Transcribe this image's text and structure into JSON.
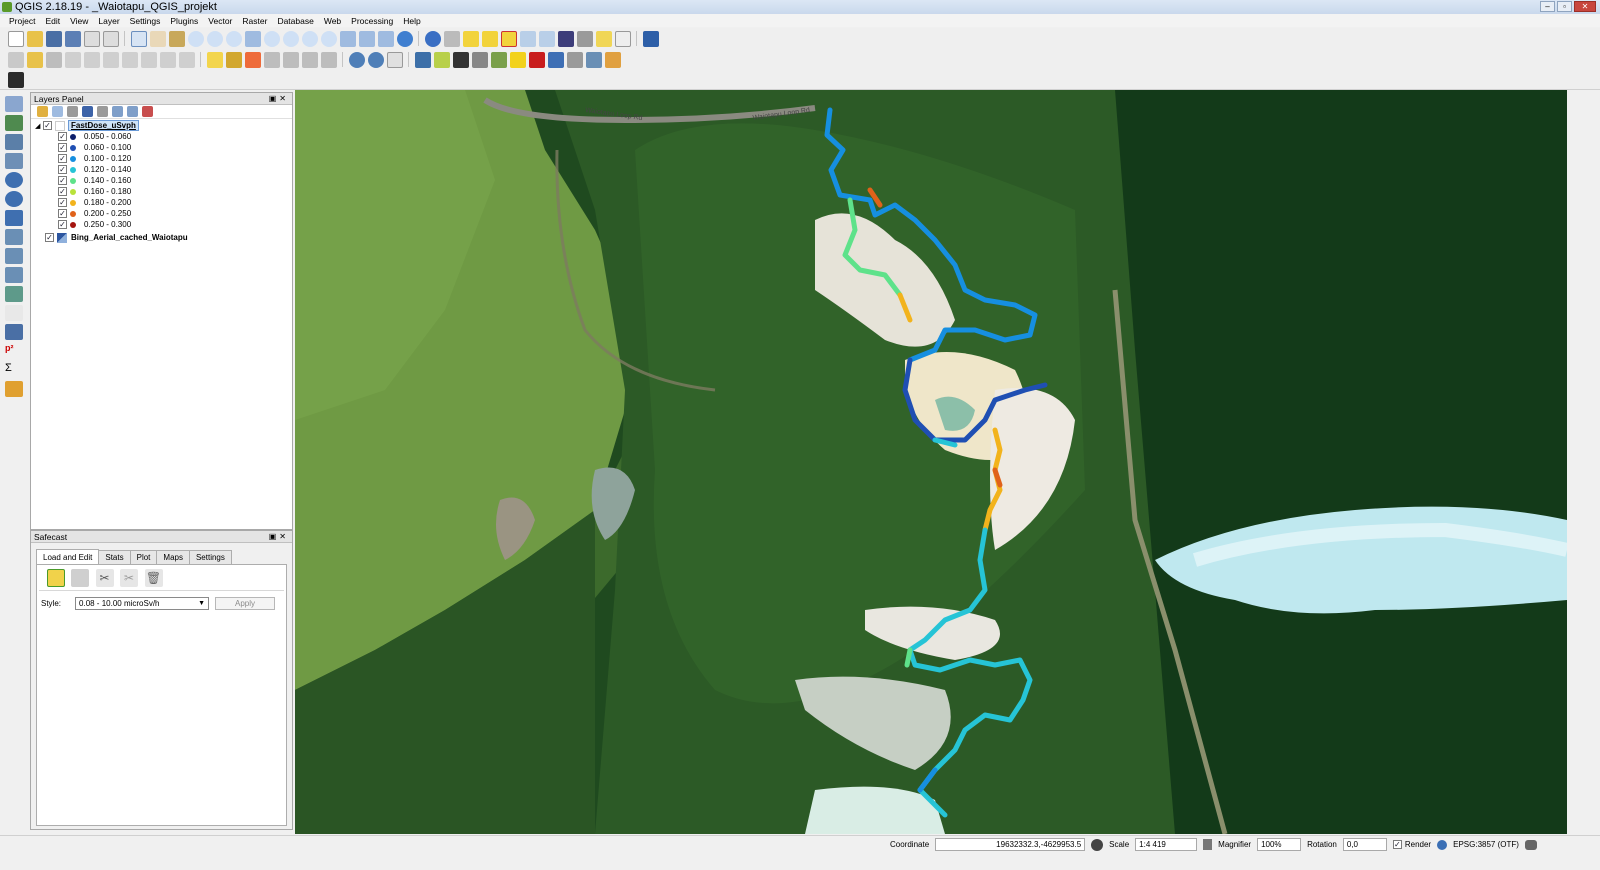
{
  "window": {
    "title": "QGIS 2.18.19 - _Waiotapu_QGIS_projekt"
  },
  "menu": [
    "Project",
    "Edit",
    "View",
    "Layer",
    "Settings",
    "Plugins",
    "Vector",
    "Raster",
    "Database",
    "Web",
    "Processing",
    "Help"
  ],
  "layers_panel": {
    "title": "Layers Panel",
    "layers": [
      {
        "name": "FastDose_uSvph",
        "classes": [
          {
            "label": "0.050 - 0.060",
            "color": "#0d1f6b"
          },
          {
            "label": "0.060 - 0.100",
            "color": "#1f4fb3"
          },
          {
            "label": "0.100 - 0.120",
            "color": "#168fe0"
          },
          {
            "label": "0.120 - 0.140",
            "color": "#26c4d6"
          },
          {
            "label": "0.140 - 0.160",
            "color": "#5ee28a"
          },
          {
            "label": "0.160 - 0.180",
            "color": "#b9e23a"
          },
          {
            "label": "0.180 - 0.200",
            "color": "#f2b31c"
          },
          {
            "label": "0.200 - 0.250",
            "color": "#e0621a"
          },
          {
            "label": "0.250 - 0.300",
            "color": "#a5140f"
          }
        ]
      },
      {
        "name": "Bing_Aerial_cached_Waiotapu"
      }
    ]
  },
  "safecast": {
    "title": "Safecast",
    "tabs": [
      "Load and Edit",
      "Stats",
      "Plot",
      "Maps",
      "Settings"
    ],
    "style_label": "Style:",
    "style_value": "0.08 - 10.00 microSv/h",
    "apply_label": "Apply"
  },
  "map": {
    "road_labels": [
      "Waiotapu Loop Rd",
      "Waiotapu Loop Rd"
    ]
  },
  "statusbar": {
    "coordinate_label": "Coordinate",
    "coordinate_value": "19632332.3,-4629953.5",
    "scale_label": "Scale",
    "scale_value": "1:4 419",
    "magnifier_label": "Magnifier",
    "magnifier_value": "100%",
    "rotation_label": "Rotation",
    "rotation_value": "0,0",
    "render_label": "Render",
    "crs": "EPSG:3857 (OTF)"
  }
}
